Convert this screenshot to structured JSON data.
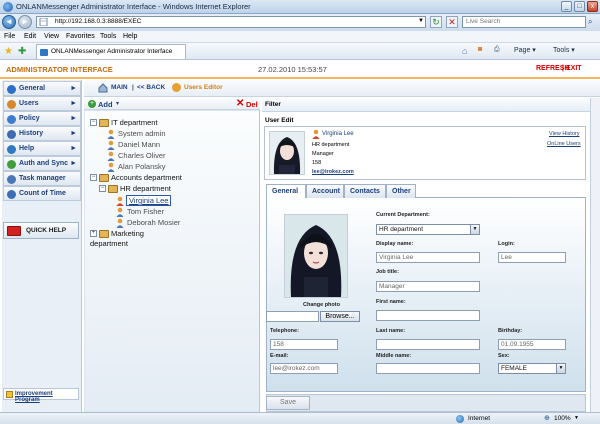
{
  "window": {
    "title": "ONLANMessenger Administrator Interface - Windows Internet Explorer",
    "minimize": "_",
    "maximize": "□",
    "close": "x"
  },
  "browser": {
    "url": "http://192.168.0.3:8888/EXEC",
    "search_placeholder": "Live Search",
    "menu": [
      "File",
      "Edit",
      "View",
      "Favorites",
      "Tools",
      "Help"
    ],
    "tab_title": "ONLANMessenger Administrator Interface",
    "page_menu": "Page",
    "tools_menu": "Tools",
    "status_zone": "Internet",
    "zoom": "100%"
  },
  "app": {
    "title": "ADMINISTRATOR INTERFACE",
    "datetime": "27.02.2010 15:53:57",
    "refresh": "REFRESH",
    "separator": "|",
    "exit": "EXIT"
  },
  "sidebar": {
    "items": [
      {
        "label": "General",
        "icon": "globe-icon",
        "color": "#2b6fc9"
      },
      {
        "label": "Users",
        "icon": "users-icon",
        "color": "#d8872a"
      },
      {
        "label": "Policy",
        "icon": "policy-icon",
        "color": "#3e7ccf"
      },
      {
        "label": "History",
        "icon": "history-icon",
        "color": "#3d6bb3"
      },
      {
        "label": "Help",
        "icon": "help-icon",
        "color": "#2f78c4"
      },
      {
        "label": "Auth and Sync",
        "icon": "sync-icon",
        "color": "#3f9d3c"
      },
      {
        "label": "Task manager",
        "icon": "task-icon",
        "color": "#4b77b8"
      },
      {
        "label": "Count of Time",
        "icon": "clock-icon",
        "color": "#3c6fb5"
      }
    ],
    "arrow": "►",
    "quick_help": "QUICK HELP",
    "improvement": "Improvement Program"
  },
  "breadcrumb": {
    "main": "MAIN",
    "separator": "|",
    "back": "<< BACK",
    "editor": "Users Editor"
  },
  "tree": {
    "add_label": "Add",
    "add_caret": "▾",
    "delete_label": "Del",
    "expand_open": "−",
    "expand_closed": "+",
    "nodes": [
      {
        "label": "IT department",
        "type": "dept"
      },
      {
        "label": "System admin",
        "type": "user"
      },
      {
        "label": "Daniel Mann",
        "type": "user"
      },
      {
        "label": "Charles Oliver",
        "type": "user"
      },
      {
        "label": "Alan Polansky",
        "type": "user"
      },
      {
        "label": "Accounts department",
        "type": "dept"
      },
      {
        "label": "HR department",
        "type": "dept"
      },
      {
        "label": "Virginia Lee",
        "type": "user",
        "selected": true
      },
      {
        "label": "Tom Fisher",
        "type": "user"
      },
      {
        "label": "Deborah Mosier",
        "type": "user"
      },
      {
        "label": "Marketing",
        "type": "dept"
      },
      {
        "label": "department",
        "type": "dept"
      }
    ]
  },
  "filter": {
    "label": "Filter"
  },
  "user_edit": {
    "header": "User Edit",
    "name": "Virginia Lee",
    "department": "HR department",
    "title": "Manager",
    "number": "158",
    "email": "lee@irokez.com",
    "view_history": "View History",
    "online_users": "OnLine Users"
  },
  "tabs": [
    "General",
    "Account",
    "Contacts",
    "Other"
  ],
  "form": {
    "current_department_label": "Current Department:",
    "current_department_value": "HR department",
    "display_name_label": "Display name:",
    "display_name_value": "Virginia Lee",
    "login_label": "Login:",
    "login_value": "Lee",
    "job_title_label": "Job title:",
    "job_title_value": "Manager",
    "first_name_label": "First name:",
    "first_name_value": "",
    "change_photo_label": "Change photo",
    "browse_label": "Browse...",
    "telephone_label": "Telephone:",
    "telephone_value": "158",
    "last_name_label": "Last name:",
    "last_name_value": "",
    "birthday_label": "Birthday:",
    "birthday_value": "01.09.1955",
    "email_label": "E-mail:",
    "email_value": "lee@irokez.com",
    "middle_name_label": "Middle name:",
    "middle_name_value": "",
    "sex_label": "Sex:",
    "sex_value": "FEMALE",
    "save_label": "Save"
  }
}
